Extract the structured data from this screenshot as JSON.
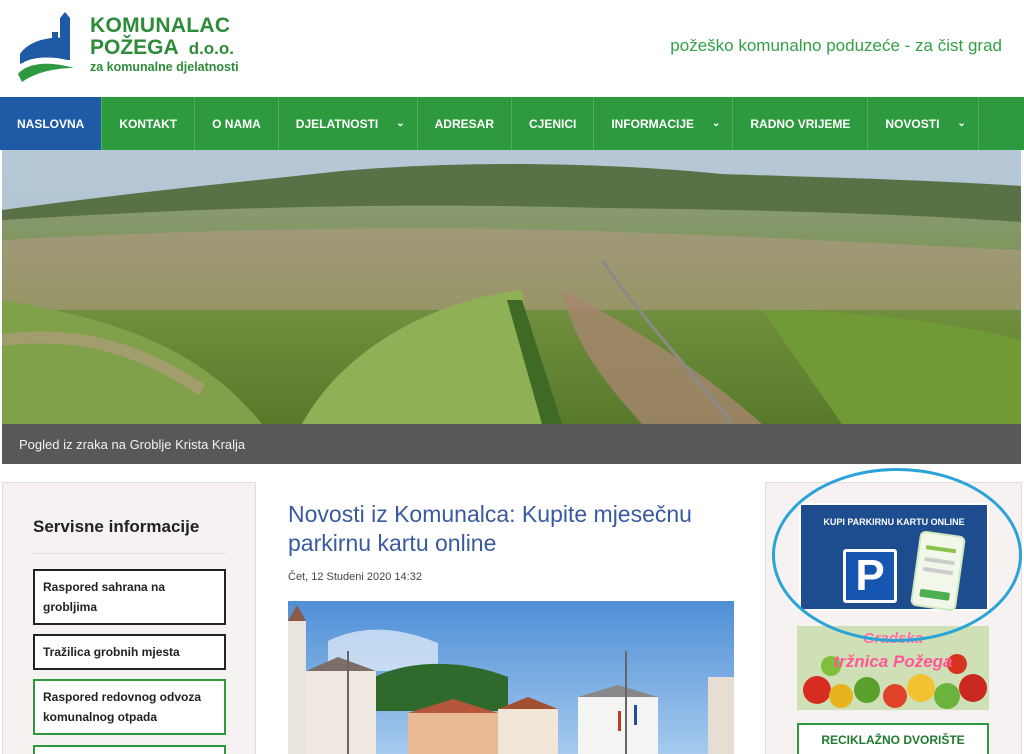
{
  "header": {
    "logo": {
      "line1": "KOMUNALAC",
      "line2": "POŽEGA",
      "line2_suffix": "d.o.o.",
      "line3": "za komunalne djelatnosti"
    },
    "tagline": "požeško komunalno poduzeće - za čist grad"
  },
  "nav": {
    "items": [
      {
        "label": "NASLOVNA",
        "active": true
      },
      {
        "label": "KONTAKT"
      },
      {
        "label": "O NAMA"
      },
      {
        "label": "DJELATNOSTI",
        "dropdown": true
      },
      {
        "label": "ADRESAR"
      },
      {
        "label": "CJENICI"
      },
      {
        "label": "INFORMACIJE",
        "dropdown": true
      },
      {
        "label": "RADNO VRIJEME"
      },
      {
        "label": "NOVOSTI",
        "dropdown": true
      }
    ],
    "dropdown_icon": "chevron-down-icon"
  },
  "hero": {
    "caption": "Pogled iz zraka na Groblje Krista Kralja"
  },
  "sidebar": {
    "title": "Servisne informacije",
    "links": [
      {
        "label": "Raspored sahrana na grobljima"
      },
      {
        "label": "Tražilica grobnih mjesta"
      },
      {
        "label": "Raspored redovnog odvoza komunalnog otpada"
      }
    ]
  },
  "article": {
    "title": "Novosti iz Komunalca: Kupite mjesečnu parkirnu kartu online",
    "date": "Čet, 12 Studeni 2020 14:32"
  },
  "right_sidebar": {
    "parking_banner": {
      "label": "KUPI PARKIRNU KARTU ONLINE",
      "letter": "P"
    },
    "market_banner": {
      "line1": "Gradska",
      "line2": "tržnica Požega"
    },
    "recycling_banner": {
      "label": "RECIKLAŽNO DVORIŠTE"
    }
  },
  "colors": {
    "nav_green": "#2e9a3f",
    "nav_active": "#1f5aa6",
    "brand_green": "#2e8b3a",
    "title_blue": "#3a5aa0",
    "highlight_circle": "#2aa3d8"
  }
}
